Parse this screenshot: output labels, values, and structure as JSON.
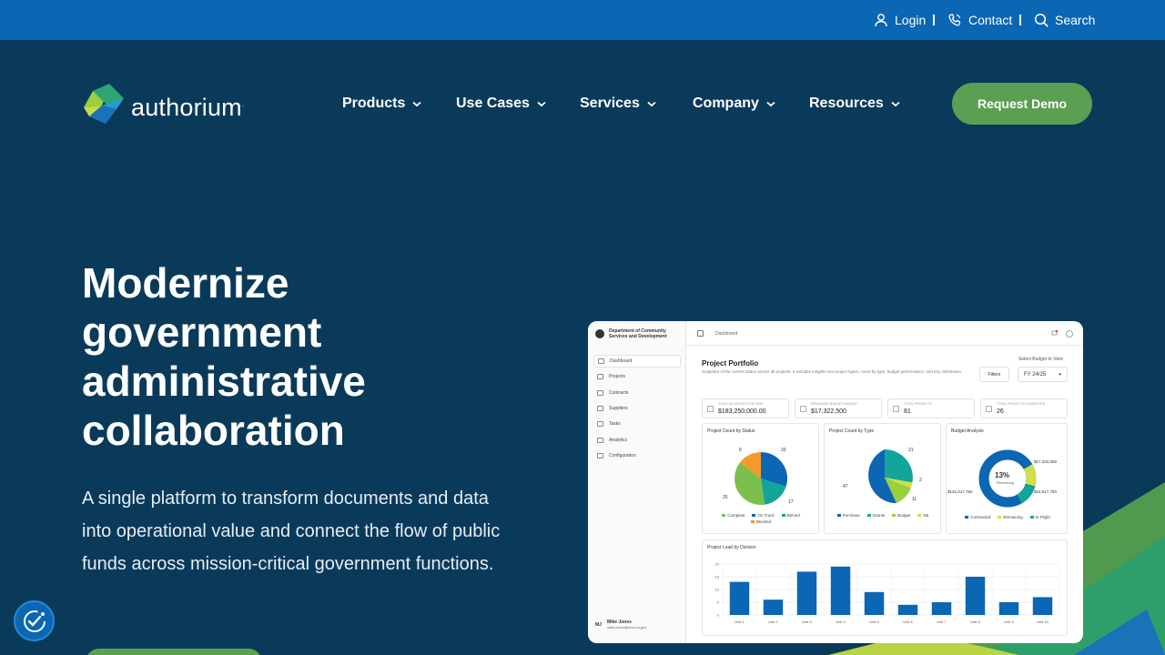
{
  "topbar": {
    "login": "Login",
    "contact": "Contact",
    "search": "Search"
  },
  "brand": {
    "name": "authorium",
    "mark": "."
  },
  "nav": {
    "items": [
      "Products",
      "Use Cases",
      "Services",
      "Company",
      "Resources"
    ],
    "cta": "Request Demo"
  },
  "hero": {
    "title": "Modernize government administrative collaboration",
    "subtitle": "A single platform to transform documents and data into operational value and connect the flow of public funds across mission-critical government functions."
  },
  "colors": {
    "primary_blue": "#0b66b3",
    "navy": "#0a3a5a",
    "green": "#5b9f52"
  },
  "dashboard": {
    "department": "Department of Community Services and Development",
    "breadcrumb": "Dashboard",
    "sidebar": [
      "Dashboard",
      "Projects",
      "Contracts",
      "Suppliers",
      "Tasks",
      "Analytics",
      "Configuration"
    ],
    "user": {
      "initials": "MJ",
      "name": "Mike Jones",
      "email": "mike.jones@dcsd.ct.gov"
    },
    "title": "Project Portfolio",
    "description": "Snapshot of the current status across all projects. It includes insights into project types, count by type, budget performance, and key milestones.",
    "filters": "Filters",
    "select_label": "Select Budget to View",
    "select_value": "FY 24/25",
    "kpis": [
      {
        "label": "TOTAL ALLOCATED FOR 2025",
        "value": "$183,250,000.00"
      },
      {
        "label": "REMAINING BUDGET AMOUNT",
        "value": "$17,322,500"
      },
      {
        "label": "TOTAL PROJECTS",
        "value": "81"
      },
      {
        "label": "TOTAL PROJECTS COMPLETED",
        "value": "26"
      }
    ],
    "status_card": {
      "title": "Project Count by Status",
      "labels": [
        "6",
        "33",
        "25",
        "17"
      ],
      "legend": [
        "Complete",
        "On Track",
        "Behind",
        "Blocked"
      ]
    },
    "type_card": {
      "title": "Project Count by Type",
      "labels": [
        "21",
        "2",
        "47",
        "11"
      ],
      "legend": [
        "Purchase",
        "Grants",
        "Budget",
        "SB"
      ]
    },
    "budget_card": {
      "title": "Budget Analysis",
      "center_value": "13%",
      "center_label": "Remaining",
      "labels": [
        "$17,322,500",
        "$16,917,750",
        "$131,617,750"
      ],
      "legend": [
        "Contracted",
        "Remaining",
        "In Flight"
      ]
    },
    "division_card": {
      "title": "Project Load by Division",
      "yticks": [
        "20",
        "15",
        "10",
        "5",
        "0"
      ],
      "categories": [
        "Unit 1",
        "Unit 2",
        "Unit 3",
        "Unit 4",
        "Unit 5",
        "Unit 6",
        "Unit 7",
        "Unit 8",
        "Unit 9",
        "Unit 10"
      ],
      "values": [
        13,
        6,
        17,
        19,
        9,
        4,
        5,
        15,
        5,
        7
      ]
    }
  }
}
